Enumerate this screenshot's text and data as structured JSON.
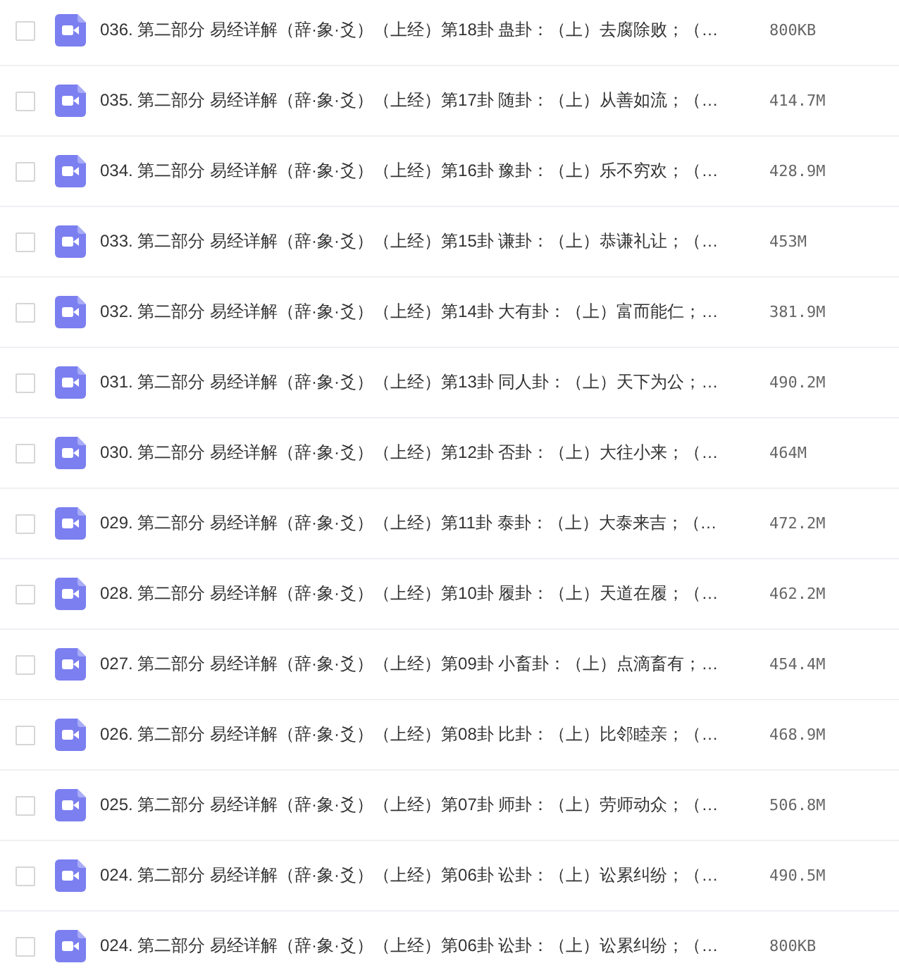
{
  "files": [
    {
      "name": "036. 第二部分 易经详解（辞·象·爻）（上经）第18卦 蛊卦：（上）去腐除败；（…",
      "size": "800KB",
      "checked": false
    },
    {
      "name": "035. 第二部分 易经详解（辞·象·爻）（上经）第17卦 随卦：（上）从善如流；（…",
      "size": "414.7M",
      "checked": false
    },
    {
      "name": "034. 第二部分 易经详解（辞·象·爻）（上经）第16卦 豫卦：（上）乐不穷欢；（…",
      "size": "428.9M",
      "checked": false
    },
    {
      "name": "033. 第二部分 易经详解（辞·象·爻）（上经）第15卦 谦卦：（上）恭谦礼让；（…",
      "size": "453M",
      "checked": false
    },
    {
      "name": "032. 第二部分 易经详解（辞·象·爻）（上经）第14卦 大有卦：（上）富而能仁；…",
      "size": "381.9M",
      "checked": false
    },
    {
      "name": "031. 第二部分 易经详解（辞·象·爻）（上经）第13卦 同人卦：（上）天下为公；…",
      "size": "490.2M",
      "checked": false
    },
    {
      "name": "030. 第二部分 易经详解（辞·象·爻）（上经）第12卦 否卦：（上）大往小来；（…",
      "size": "464M",
      "checked": false
    },
    {
      "name": "029. 第二部分 易经详解（辞·象·爻）（上经）第11卦 泰卦：（上）大泰来吉；（…",
      "size": "472.2M",
      "checked": false
    },
    {
      "name": "028. 第二部分 易经详解（辞·象·爻）（上经）第10卦 履卦：（上）天道在履；（…",
      "size": "462.2M",
      "checked": false
    },
    {
      "name": "027. 第二部分 易经详解（辞·象·爻）（上经）第09卦 小畜卦：（上）点滴畜有；…",
      "size": "454.4M",
      "checked": false
    },
    {
      "name": "026. 第二部分 易经详解（辞·象·爻）（上经）第08卦 比卦：（上）比邻睦亲；（…",
      "size": "468.9M",
      "checked": false
    },
    {
      "name": "025. 第二部分 易经详解（辞·象·爻）（上经）第07卦 师卦：（上）劳师动众；（…",
      "size": "506.8M",
      "checked": false
    },
    {
      "name": "024. 第二部分 易经详解（辞·象·爻）（上经）第06卦 讼卦：（上）讼累纠纷；（…",
      "size": "490.5M",
      "checked": false
    },
    {
      "name": "024. 第二部分 易经详解（辞·象·爻）（上经）第06卦 讼卦：（上）讼累纠纷；（…",
      "size": "800KB",
      "checked": false
    }
  ]
}
